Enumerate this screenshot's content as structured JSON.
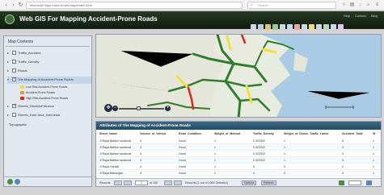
{
  "browser": {
    "url": "microsoft  https://web.ai-site/map/index.html",
    "search_placeholder": "Search"
  },
  "app": {
    "title": "Web GIS For Mapping Accident-Prone Roads",
    "top_links": [
      "Help",
      "Contact",
      "Blog"
    ]
  },
  "map_contents": {
    "title": "Map Contents",
    "layers": [
      {
        "label": "Traffic_Accident",
        "checked": false,
        "expanded": false
      },
      {
        "label": "Traffic_Density",
        "checked": false,
        "expanded": false
      },
      {
        "label": "Roads",
        "checked": false,
        "expanded": false
      },
      {
        "label": "The Mapping of Accident-Prone Roads",
        "checked": true,
        "expanded": true
      },
      {
        "label": "Streets_DistrictsEntrance",
        "checked": true,
        "expanded": false
      },
      {
        "label": "Streets_East Java_Indonesia",
        "checked": false,
        "expanded": false
      }
    ],
    "legend": [
      {
        "label": "Low Risk Accident-Prone Roads",
        "color": "#f0e13a"
      },
      {
        "label": "Accident-Prone Roads",
        "color": "#e89b2c"
      },
      {
        "label": "High Risk Accident-Prone Roads",
        "color": "#d8281f"
      }
    ],
    "extra_item": "Topographic"
  },
  "attributes": {
    "title": "Attributes of The Mapping of Accident-Prone Roads",
    "columns": [
      "Street_Name",
      "Volume_of_Vehicle",
      "Road_Condition",
      "Weight_of_Method",
      "Traffic_Density",
      "Weight_of_Dense_Traffic_Lanes",
      "Accident_Total",
      "W"
    ],
    "rows": [
      [
        "Jl Raya Babtun sudamat",
        "3",
        "Good",
        "1",
        "0.322932",
        "1",
        "8",
        "1"
      ],
      [
        "Jl Raya Babtun sudamat",
        "3",
        "Good",
        "1",
        "0.322932",
        "1",
        "4",
        "1"
      ],
      [
        "Jl Raya Babtun sudamat",
        "3",
        "Good",
        "1",
        "0.322932",
        "1",
        "3",
        "1"
      ],
      [
        "Jl Raya Babtun sudamat",
        "3",
        "Good",
        "1",
        "0.322932",
        "1",
        "5",
        "1"
      ],
      [
        "Jl Raya Harisal",
        "4",
        "Good",
        "1",
        "0",
        "0",
        "2",
        "1"
      ],
      [
        "Jl Raya Babungan",
        "3",
        "Good",
        "1",
        "0",
        "0",
        "4",
        "1"
      ]
    ],
    "pager": {
      "label": "Records",
      "page": "1",
      "of": "of 100",
      "status": "Records (1 out of 1000 Selected)",
      "options": "Options",
      "refresh": "Refresh"
    }
  },
  "colors": {
    "header_bg": "#1b2d19",
    "panel_bg": "#e1e8ef",
    "road_green": "#2f7d2a",
    "road_yellow": "#f0e13a",
    "road_red": "#d8281f"
  }
}
